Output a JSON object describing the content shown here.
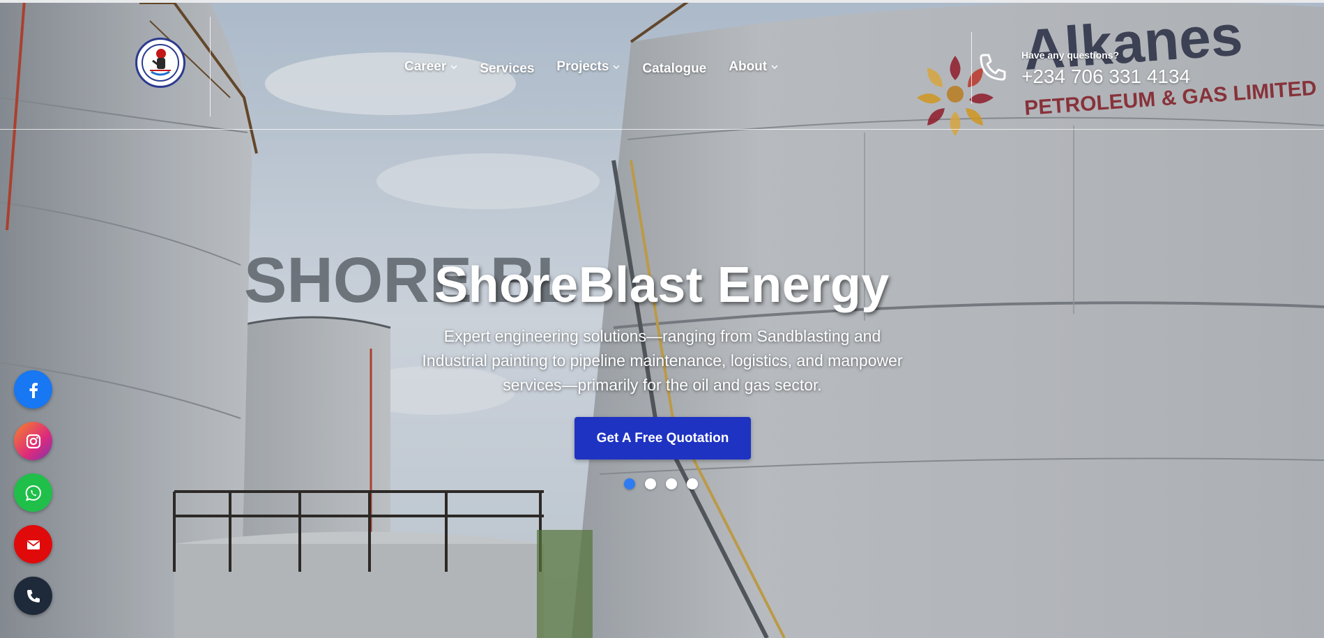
{
  "nav": {
    "items": [
      {
        "label": "Career",
        "has_dropdown": true
      },
      {
        "label": "Services",
        "has_dropdown": false
      },
      {
        "label": "Projects",
        "has_dropdown": true
      },
      {
        "label": "Catalogue",
        "has_dropdown": false
      },
      {
        "label": "About",
        "has_dropdown": true
      }
    ]
  },
  "contact": {
    "question": "Have any questions?",
    "phone": "+234 706 331 4134",
    "icon": "phone-icon"
  },
  "background_signage": {
    "tank_brand_line1": "Alkanes",
    "tank_brand_line2": "PETROLEUM & GAS LIMITED",
    "faded_text": "SHORE BL"
  },
  "hero": {
    "title": "ShoreBlast Energy",
    "description": "Expert engineering solutions—ranging from Sandblasting and Industrial painting to pipeline maintenance, logistics, and manpower services—primarily for the oil and gas sector.",
    "cta_label": "Get A Free Quotation",
    "slides_total": 4,
    "active_slide": 1
  },
  "social": [
    {
      "name": "facebook",
      "icon": "facebook-icon",
      "color": "#1877f2"
    },
    {
      "name": "instagram",
      "icon": "instagram-icon",
      "color": "#e1306c"
    },
    {
      "name": "whatsapp",
      "icon": "whatsapp-icon",
      "color": "#1fbf4a"
    },
    {
      "name": "email",
      "icon": "mail-icon",
      "color": "#e00a0a"
    },
    {
      "name": "phone",
      "icon": "phone-icon",
      "color": "#1e2a3a"
    }
  ],
  "colors": {
    "cta": "#1f33c2",
    "active_dot": "#2f7bf3"
  }
}
